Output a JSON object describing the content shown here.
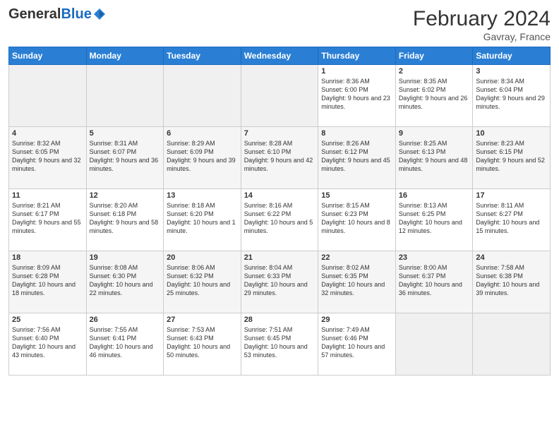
{
  "logo": {
    "general": "General",
    "blue": "Blue"
  },
  "header": {
    "title": "February 2024",
    "subtitle": "Gavray, France"
  },
  "days_of_week": [
    "Sunday",
    "Monday",
    "Tuesday",
    "Wednesday",
    "Thursday",
    "Friday",
    "Saturday"
  ],
  "weeks": [
    [
      {
        "day": "",
        "info": ""
      },
      {
        "day": "",
        "info": ""
      },
      {
        "day": "",
        "info": ""
      },
      {
        "day": "",
        "info": ""
      },
      {
        "day": "1",
        "info": "Sunrise: 8:36 AM\nSunset: 6:00 PM\nDaylight: 9 hours and 23 minutes."
      },
      {
        "day": "2",
        "info": "Sunrise: 8:35 AM\nSunset: 6:02 PM\nDaylight: 9 hours and 26 minutes."
      },
      {
        "day": "3",
        "info": "Sunrise: 8:34 AM\nSunset: 6:04 PM\nDaylight: 9 hours and 29 minutes."
      }
    ],
    [
      {
        "day": "4",
        "info": "Sunrise: 8:32 AM\nSunset: 6:05 PM\nDaylight: 9 hours and 32 minutes."
      },
      {
        "day": "5",
        "info": "Sunrise: 8:31 AM\nSunset: 6:07 PM\nDaylight: 9 hours and 36 minutes."
      },
      {
        "day": "6",
        "info": "Sunrise: 8:29 AM\nSunset: 6:09 PM\nDaylight: 9 hours and 39 minutes."
      },
      {
        "day": "7",
        "info": "Sunrise: 8:28 AM\nSunset: 6:10 PM\nDaylight: 9 hours and 42 minutes."
      },
      {
        "day": "8",
        "info": "Sunrise: 8:26 AM\nSunset: 6:12 PM\nDaylight: 9 hours and 45 minutes."
      },
      {
        "day": "9",
        "info": "Sunrise: 8:25 AM\nSunset: 6:13 PM\nDaylight: 9 hours and 48 minutes."
      },
      {
        "day": "10",
        "info": "Sunrise: 8:23 AM\nSunset: 6:15 PM\nDaylight: 9 hours and 52 minutes."
      }
    ],
    [
      {
        "day": "11",
        "info": "Sunrise: 8:21 AM\nSunset: 6:17 PM\nDaylight: 9 hours and 55 minutes."
      },
      {
        "day": "12",
        "info": "Sunrise: 8:20 AM\nSunset: 6:18 PM\nDaylight: 9 hours and 58 minutes."
      },
      {
        "day": "13",
        "info": "Sunrise: 8:18 AM\nSunset: 6:20 PM\nDaylight: 10 hours and 1 minute."
      },
      {
        "day": "14",
        "info": "Sunrise: 8:16 AM\nSunset: 6:22 PM\nDaylight: 10 hours and 5 minutes."
      },
      {
        "day": "15",
        "info": "Sunrise: 8:15 AM\nSunset: 6:23 PM\nDaylight: 10 hours and 8 minutes."
      },
      {
        "day": "16",
        "info": "Sunrise: 8:13 AM\nSunset: 6:25 PM\nDaylight: 10 hours and 12 minutes."
      },
      {
        "day": "17",
        "info": "Sunrise: 8:11 AM\nSunset: 6:27 PM\nDaylight: 10 hours and 15 minutes."
      }
    ],
    [
      {
        "day": "18",
        "info": "Sunrise: 8:09 AM\nSunset: 6:28 PM\nDaylight: 10 hours and 18 minutes."
      },
      {
        "day": "19",
        "info": "Sunrise: 8:08 AM\nSunset: 6:30 PM\nDaylight: 10 hours and 22 minutes."
      },
      {
        "day": "20",
        "info": "Sunrise: 8:06 AM\nSunset: 6:32 PM\nDaylight: 10 hours and 25 minutes."
      },
      {
        "day": "21",
        "info": "Sunrise: 8:04 AM\nSunset: 6:33 PM\nDaylight: 10 hours and 29 minutes."
      },
      {
        "day": "22",
        "info": "Sunrise: 8:02 AM\nSunset: 6:35 PM\nDaylight: 10 hours and 32 minutes."
      },
      {
        "day": "23",
        "info": "Sunrise: 8:00 AM\nSunset: 6:37 PM\nDaylight: 10 hours and 36 minutes."
      },
      {
        "day": "24",
        "info": "Sunrise: 7:58 AM\nSunset: 6:38 PM\nDaylight: 10 hours and 39 minutes."
      }
    ],
    [
      {
        "day": "25",
        "info": "Sunrise: 7:56 AM\nSunset: 6:40 PM\nDaylight: 10 hours and 43 minutes."
      },
      {
        "day": "26",
        "info": "Sunrise: 7:55 AM\nSunset: 6:41 PM\nDaylight: 10 hours and 46 minutes."
      },
      {
        "day": "27",
        "info": "Sunrise: 7:53 AM\nSunset: 6:43 PM\nDaylight: 10 hours and 50 minutes."
      },
      {
        "day": "28",
        "info": "Sunrise: 7:51 AM\nSunset: 6:45 PM\nDaylight: 10 hours and 53 minutes."
      },
      {
        "day": "29",
        "info": "Sunrise: 7:49 AM\nSunset: 6:46 PM\nDaylight: 10 hours and 57 minutes."
      },
      {
        "day": "",
        "info": ""
      },
      {
        "day": "",
        "info": ""
      }
    ]
  ]
}
